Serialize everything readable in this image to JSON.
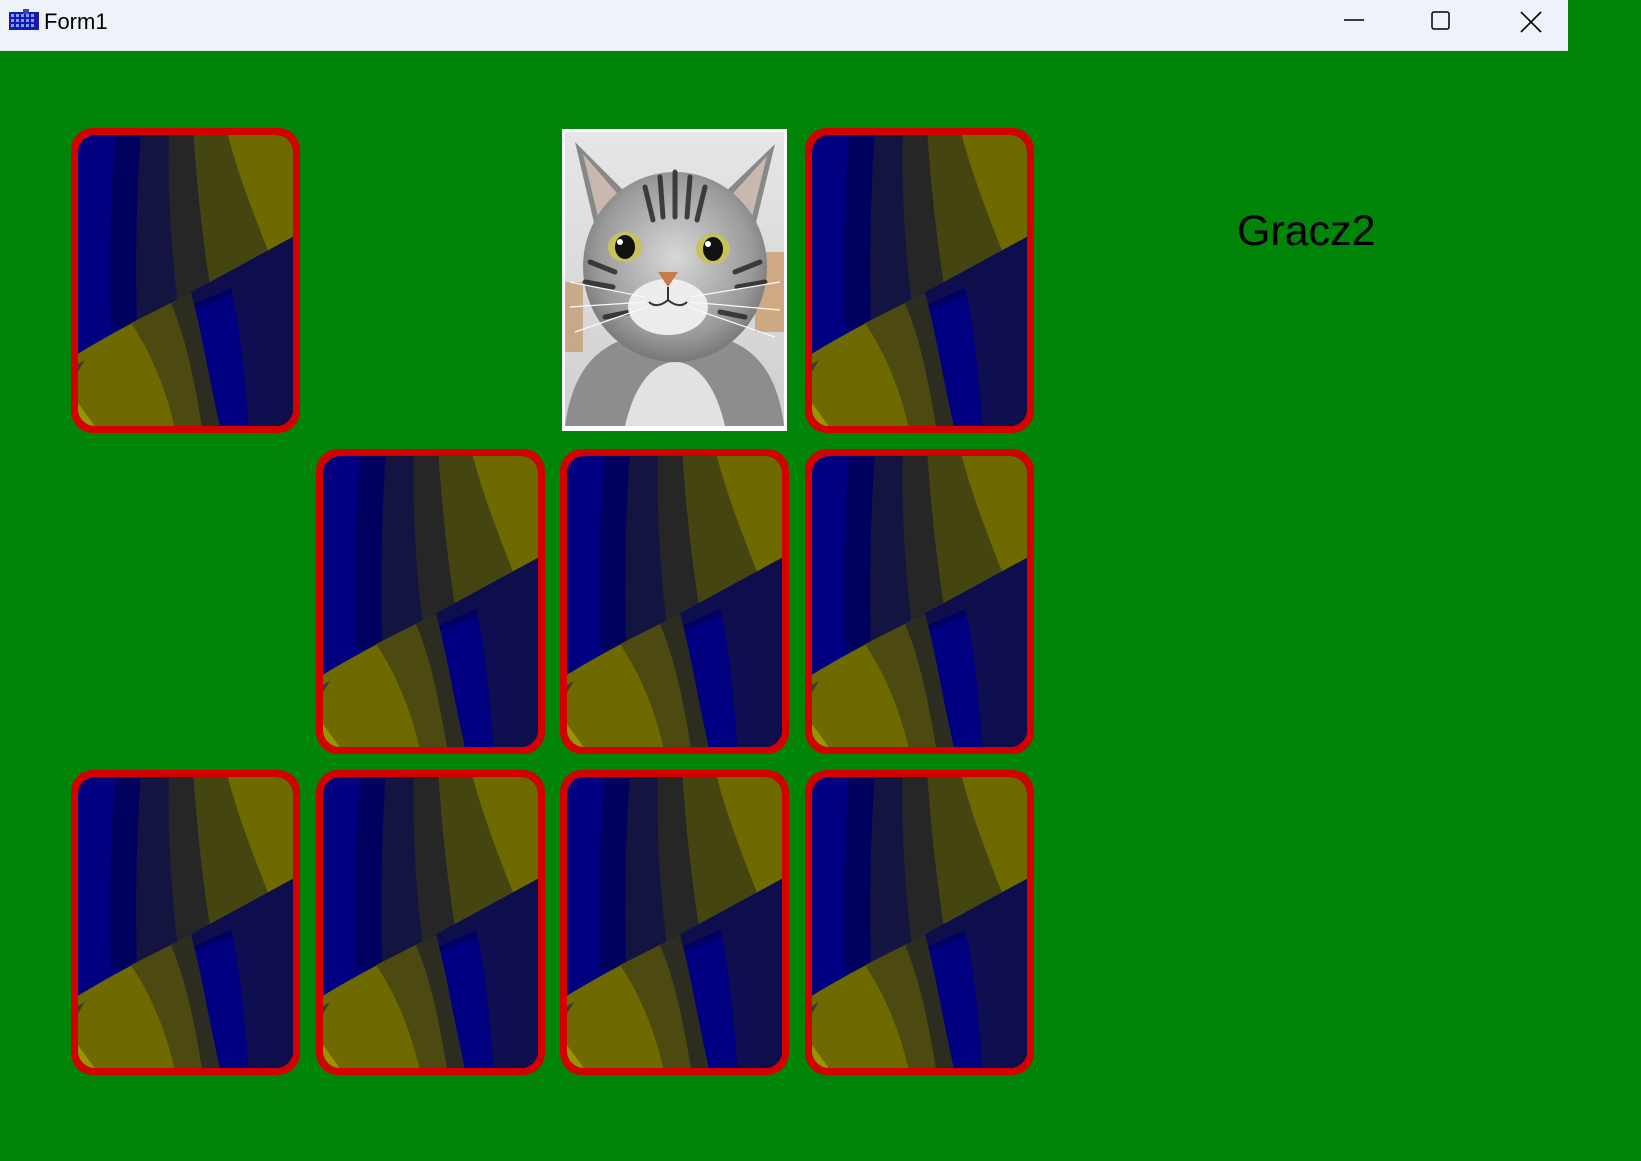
{
  "window": {
    "title": "Form1",
    "icon": "app-grid-icon",
    "controls": [
      "minimize-icon",
      "maximize-icon",
      "close-icon"
    ]
  },
  "game": {
    "player_label": "Gracz2",
    "colors": {
      "table": "#008509",
      "card_border": "#d40000",
      "face_frame": "#ffffff"
    },
    "grid": {
      "rows": 3,
      "cols": 4,
      "cells": [
        {
          "row": 1,
          "col": 1,
          "state": "back"
        },
        {
          "row": 1,
          "col": 2,
          "state": "removed"
        },
        {
          "row": 1,
          "col": 3,
          "state": "face-up",
          "image": "tabby-cat"
        },
        {
          "row": 1,
          "col": 4,
          "state": "back"
        },
        {
          "row": 2,
          "col": 1,
          "state": "removed"
        },
        {
          "row": 2,
          "col": 2,
          "state": "back"
        },
        {
          "row": 2,
          "col": 3,
          "state": "back"
        },
        {
          "row": 2,
          "col": 4,
          "state": "back"
        },
        {
          "row": 3,
          "col": 1,
          "state": "back"
        },
        {
          "row": 3,
          "col": 2,
          "state": "back"
        },
        {
          "row": 3,
          "col": 3,
          "state": "back"
        },
        {
          "row": 3,
          "col": 4,
          "state": "back"
        }
      ]
    }
  }
}
